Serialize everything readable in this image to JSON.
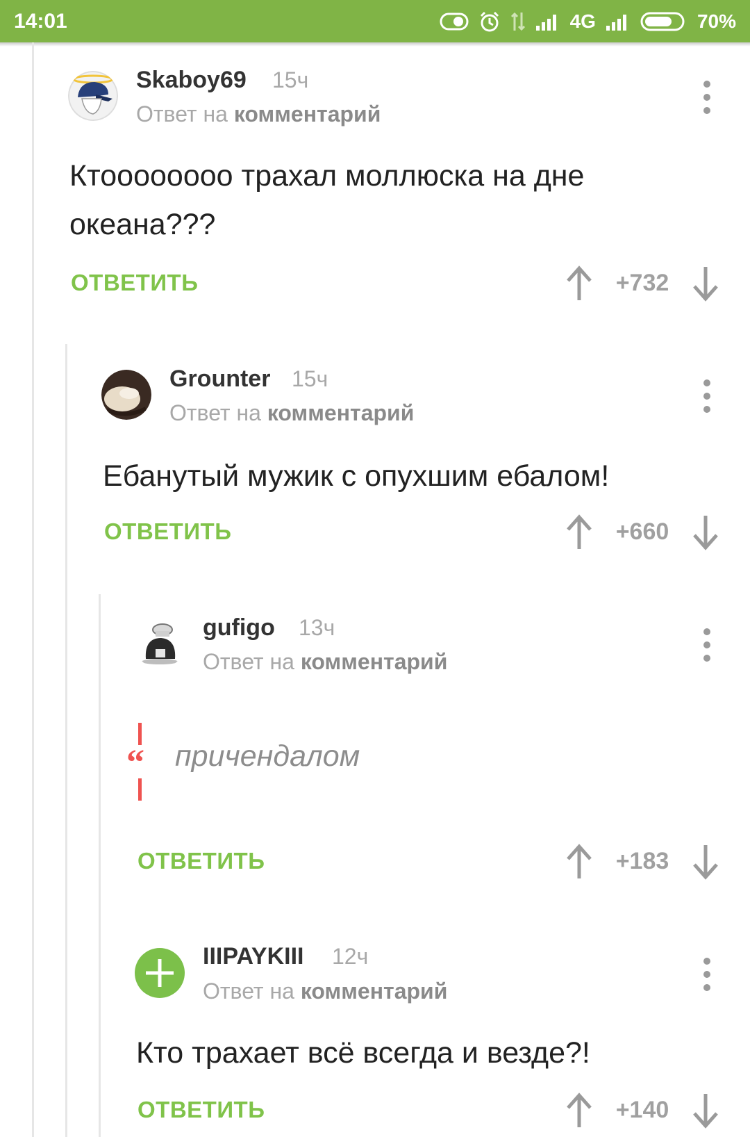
{
  "status_bar": {
    "time": "14:01",
    "network": "4G",
    "battery": "70%"
  },
  "colors": {
    "brand_green": "#80b446",
    "reply_green": "#80c34a",
    "quote_red": "#ef5350"
  },
  "comments": [
    {
      "author": "Skaboy69",
      "time": "15ч",
      "reply_prefix": "Ответ на",
      "reply_link": "комментарий",
      "text": "Ктоооооооо трахал моллюска на дне океана???",
      "reply_label": "ОТВЕТИТЬ",
      "score": "+732",
      "avatar": "cap-avatar"
    },
    {
      "author": "Grounter",
      "time": "15ч",
      "reply_prefix": "Ответ на",
      "reply_link": "комментарий",
      "text": "Ебанутый мужик с опухшим ебалом!",
      "reply_label": "ОТВЕТИТЬ",
      "score": "+660",
      "avatar": "photo-avatar"
    },
    {
      "author": "gufigo",
      "time": "13ч",
      "reply_prefix": "Ответ на",
      "reply_link": "комментарий",
      "quote": "причендалом",
      "reply_label": "ОТВЕТИТЬ",
      "score": "+183",
      "avatar": "chef-avatar"
    },
    {
      "author": "IIIPAYKIII",
      "time": "12ч",
      "reply_prefix": "Ответ на",
      "reply_link": "комментарий",
      "text": "Кто трахает всё всегда и везде?!",
      "reply_label": "ОТВЕТИТЬ",
      "score": "+140",
      "avatar": "plus-avatar"
    }
  ]
}
